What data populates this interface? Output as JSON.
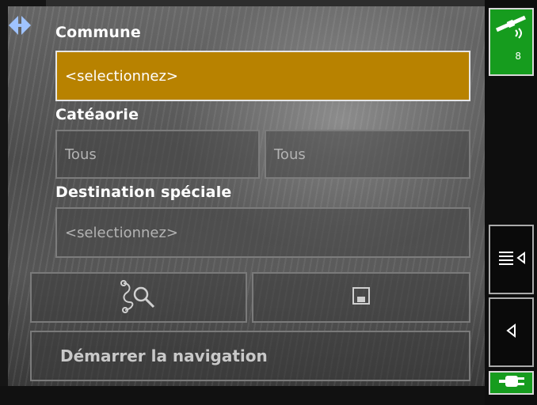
{
  "form": {
    "commune_label": "Commune",
    "commune_value": "<selectionnez>",
    "categorie_label": "Catéaorie",
    "categorie_values": [
      "Tous",
      "Tous"
    ],
    "destination_label": "Destination spéciale",
    "destination_value": "<selectionnez>"
  },
  "actions": {
    "search_icon": "search-map-icon",
    "save_icon": "save-icon",
    "start_navigation_label": "Démarrer la navigation"
  },
  "status": {
    "gps_satellites": "8",
    "gps_icon": "satellite-icon",
    "power_icon": "power-plug-icon"
  },
  "side": {
    "menu_icon": "menu-list-icon",
    "back_icon": "back-arrow-icon"
  },
  "colors": {
    "active_field": "#b88200",
    "gps_green": "#169c1e"
  }
}
